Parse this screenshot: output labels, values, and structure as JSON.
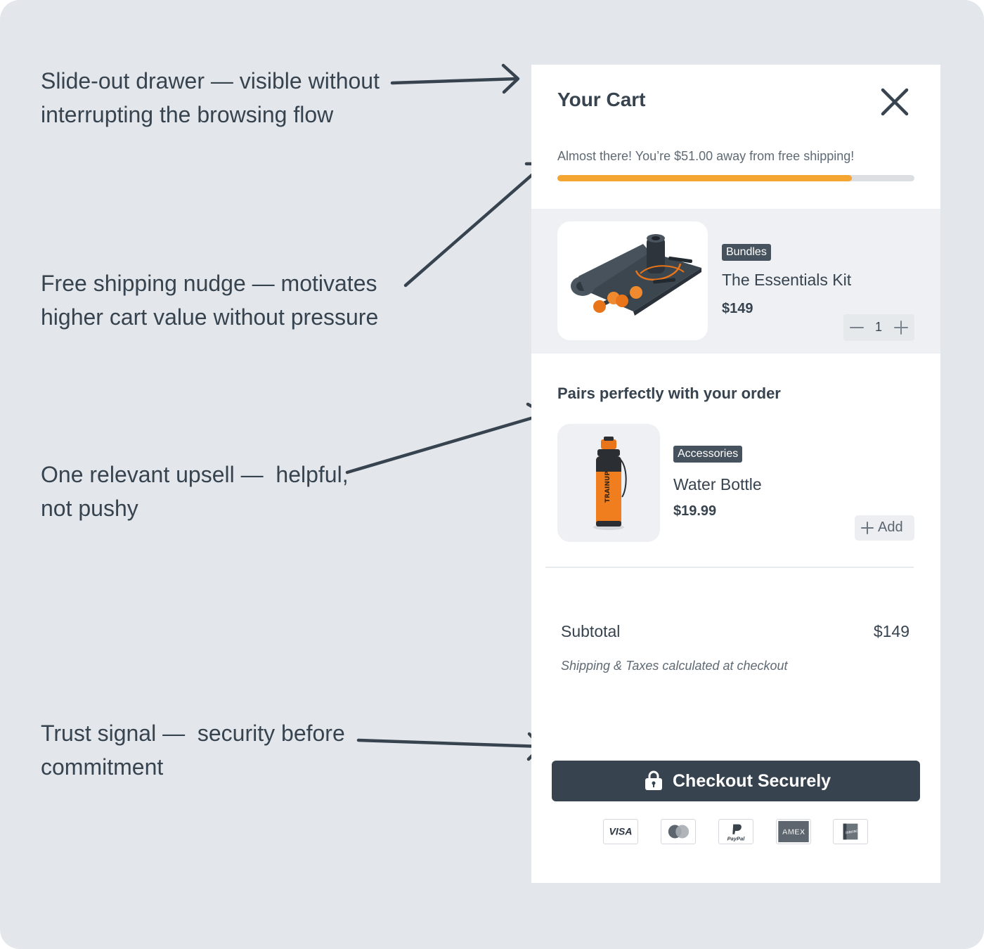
{
  "annotations": {
    "drawer": [
      "Slide-out drawer — visible without",
      "interrupting the browsing flow"
    ],
    "shipping_nudge": [
      "Free shipping nudge — motivates",
      "higher cart value without pressure"
    ],
    "upsell": [
      "One relevant upsell —  helpful,",
      "not pushy"
    ],
    "trust": [
      "Trust signal —  security before",
      "commitment"
    ]
  },
  "cart": {
    "title": "Your Cart",
    "shipping_message": "Almost there! You’re $51.00 away from free shipping!",
    "shipping_progress": 0.825,
    "item": {
      "badge": "Bundles",
      "name": "The Essentials Kit",
      "price": "$149",
      "quantity": "1"
    },
    "upsell": {
      "heading": "Pairs perfectly with your order",
      "badge": "Accessories",
      "name": "Water Bottle",
      "price": "$19.99",
      "add_label": "Add",
      "bottle_print": "TRAINUP"
    },
    "subtotal_label": "Subtotal",
    "subtotal_value": "$149",
    "shipping_note": "Shipping & Taxes calculated at checkout",
    "checkout_label": "Checkout Securely",
    "payment_methods": [
      "VISA",
      "Mastercard",
      "PayPal",
      "AMEX",
      "Interac"
    ]
  },
  "colors": {
    "background": "#e3e7eb",
    "text": "#37434f",
    "accent": "#f5a531",
    "button": "#37434f"
  }
}
